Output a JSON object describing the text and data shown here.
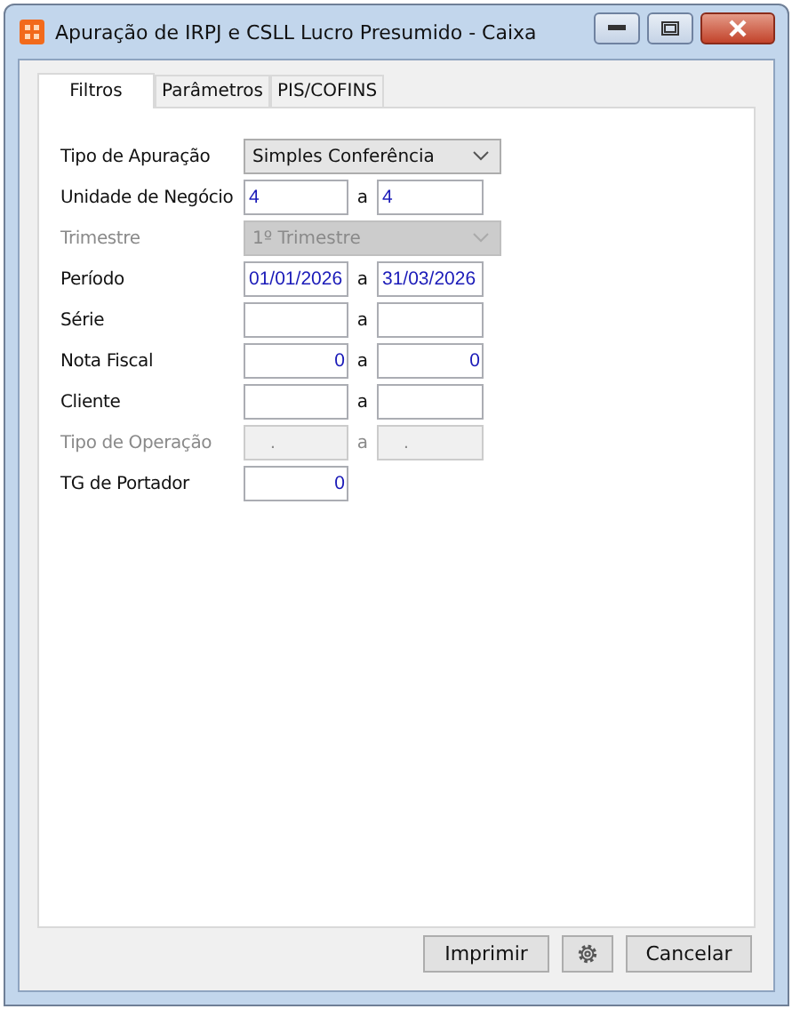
{
  "window": {
    "title": "Apuração de IRPJ e CSLL Lucro Presumido - Caixa"
  },
  "tabs": [
    {
      "label": "Filtros",
      "selected": true
    },
    {
      "label": "Parâmetros",
      "selected": false
    },
    {
      "label": "PIS/COFINS",
      "selected": false
    }
  ],
  "fields": [
    {
      "kind": "combo",
      "label": "Tipo de Apuração",
      "disabled": false,
      "value": "Simples Conferência"
    },
    {
      "kind": "range",
      "label": "Unidade de Negócio",
      "disabled": false,
      "from": "4",
      "separator": "a",
      "to": "4"
    },
    {
      "kind": "combo",
      "label": "Trimestre",
      "disabled": true,
      "value": "1º Trimestre"
    },
    {
      "kind": "range",
      "label": "Período",
      "disabled": false,
      "from": "01/01/2026",
      "separator": "a",
      "to": "31/03/2026"
    },
    {
      "kind": "range",
      "label": "Série",
      "disabled": false,
      "separator": "a"
    },
    {
      "kind": "range",
      "label": "Nota Fiscal",
      "disabled": false,
      "numeric": true,
      "from": "0",
      "separator": "a",
      "to": "0"
    },
    {
      "kind": "range",
      "label": "Cliente",
      "disabled": false,
      "separator": "a"
    },
    {
      "kind": "range",
      "label": "Tipo de Operação",
      "disabled": true,
      "from": ".",
      "separator": "a",
      "to": "."
    },
    {
      "kind": "single",
      "label": "TG de Portador",
      "disabled": false,
      "numeric": true,
      "value": "0"
    }
  ],
  "buttons": [
    {
      "kind": "text",
      "label": "Imprimir"
    },
    {
      "kind": "settings"
    },
    {
      "kind": "text",
      "label": "Cancelar"
    }
  ]
}
